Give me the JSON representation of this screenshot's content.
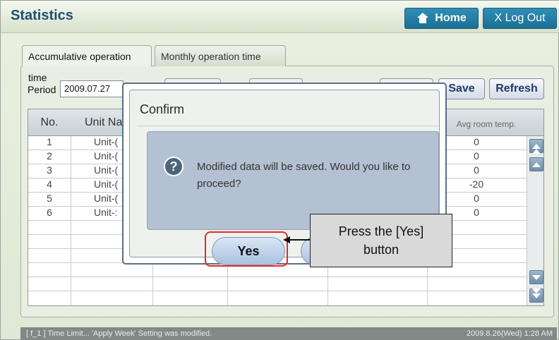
{
  "app": {
    "title": "Statistics",
    "home_label": "Home",
    "logout_label": "X Log Out"
  },
  "tabs": [
    {
      "label": "Accumulative operation time"
    },
    {
      "label": "Monthly operation time"
    }
  ],
  "period": {
    "label": "Period",
    "value": "2009.07.27"
  },
  "toolbar": {
    "save_label": "Save",
    "refresh_label": "Refresh"
  },
  "table": {
    "headers": {
      "no": "No.",
      "unit": "Unit Na",
      "avg": "Avg room temp."
    },
    "rows": [
      {
        "no": "1",
        "unit": "Unit-(",
        "avg": "0"
      },
      {
        "no": "2",
        "unit": "Unit-(",
        "avg": "0"
      },
      {
        "no": "3",
        "unit": "Unit-(",
        "avg": "0"
      },
      {
        "no": "4",
        "unit": "Unit-(",
        "avg": "-20"
      },
      {
        "no": "5",
        "unit": "Unit-(",
        "avg": "0"
      },
      {
        "no": "6",
        "unit": "Unit-:",
        "avg": "0"
      }
    ]
  },
  "dialog": {
    "title": "Confirm",
    "message": "Modified data will be saved.  Would you like to proceed?",
    "yes_label": "Yes"
  },
  "callout": {
    "text_line1": "Press the [Yes]",
    "text_line2": "button"
  },
  "status": {
    "message": "[ f_1 ] Time Limit... 'Apply Week' Setting was modified.",
    "time": "2009.8.26(Wed)  1:28 AM"
  },
  "colors": {
    "brand_blue": "#1f6e93",
    "highlight_red": "#e32a2a"
  }
}
